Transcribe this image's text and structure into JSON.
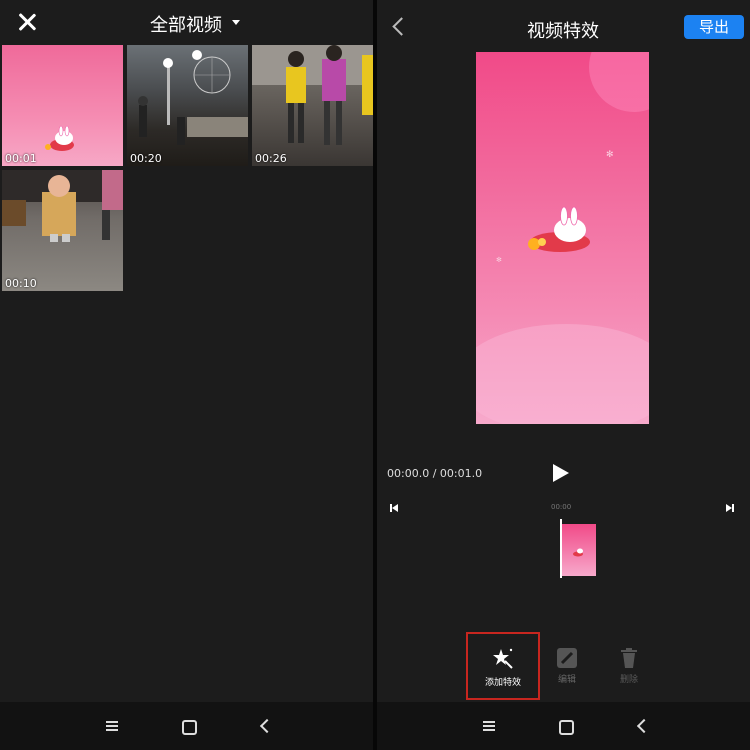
{
  "left_screen": {
    "title": "全部视频",
    "close_icon": "close-icon",
    "dropdown_icon": "caret-down-icon",
    "videos": [
      {
        "duration": "00:01"
      },
      {
        "duration": "00:20"
      },
      {
        "duration": "00:26"
      },
      {
        "duration": "00:10"
      }
    ]
  },
  "right_screen": {
    "title": "视频特效",
    "export_label": "导出",
    "back_icon": "back-chevron-icon",
    "time_display": "00:00.0 / 00:01.0",
    "timeline_mark": "00:00",
    "tools": {
      "add_effect": "添加特效",
      "edit": "编辑",
      "delete": "删除"
    }
  },
  "colors": {
    "accent_blue": "#1c82f2",
    "highlight_red": "#c8261f",
    "background": "#1c1c1c"
  }
}
